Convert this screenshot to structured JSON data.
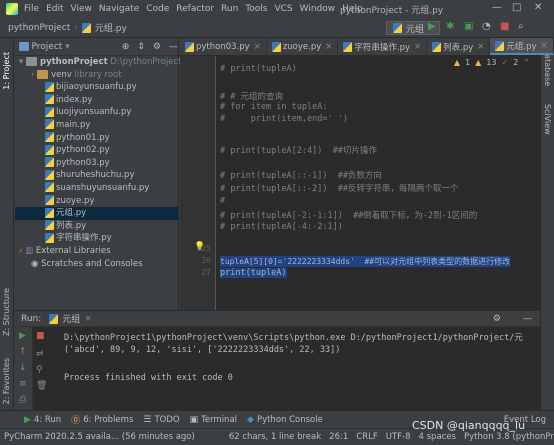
{
  "menubar": {
    "items": [
      "File",
      "Edit",
      "View",
      "Navigate",
      "Code",
      "Refactor",
      "Run",
      "Tools",
      "VCS",
      "Window",
      "Help"
    ],
    "title": "pythonProject - 元组.py"
  },
  "navbar": {
    "project": "pythonProject",
    "file": "元组.py",
    "run_config": "元组"
  },
  "left_stripe": {
    "project": "1: Project",
    "structure": "Z: Structure",
    "favorites": "2: Favorites"
  },
  "right_stripe": {
    "database": "Database",
    "sciview": "SciView"
  },
  "project_panel": {
    "title": "Project",
    "root": {
      "name": "pythonProject",
      "path": "D:\\pythonProject1\\p"
    },
    "venv": {
      "name": "venv",
      "note": "library root"
    },
    "files": [
      "bijiaoyunsuanfu.py",
      "index.py",
      "luojiyunsuanfu.py",
      "main.py",
      "python01.py",
      "python02.py",
      "python03.py",
      "shuruheshuchu.py",
      "suanshuyunsuanfu.py",
      "zuoye.py",
      "元组.py",
      "列表.py",
      "字符串操作.py"
    ],
    "selected": "元组.py",
    "external": "External Libraries",
    "scratches": "Scratches and Consoles"
  },
  "tabs": [
    {
      "label": "python03.py",
      "active": false
    },
    {
      "label": "zuoye.py",
      "active": false
    },
    {
      "label": "字符串操作.py",
      "active": false
    },
    {
      "label": "列表.py",
      "active": false
    },
    {
      "label": "元组.py",
      "active": true
    }
  ],
  "inspections": {
    "warnings": "1",
    "weak": "13",
    "typos": "2"
  },
  "editor": {
    "lines": [
      {
        "n": "",
        "text": "# print(tupleA)",
        "kind": "cmt"
      },
      {
        "n": "",
        "text": "",
        "kind": "cmt"
      },
      {
        "n": "",
        "text": "# # 元组的查询",
        "kind": "cmt"
      },
      {
        "n": "",
        "text": "# for item in tupleA:",
        "kind": "cmt"
      },
      {
        "n": "",
        "text": "#     print(item,end=' ')",
        "kind": "cmt"
      },
      {
        "n": "",
        "text": "",
        "kind": "cmt"
      },
      {
        "n": "",
        "text": "# print(tupleA[2:4])  ##切片操作",
        "kind": "cmt"
      },
      {
        "n": "",
        "text": "",
        "kind": "cmt"
      },
      {
        "n": "",
        "text": "# print(tupleA[::-1])  ##负数方向",
        "kind": "cmt"
      },
      {
        "n": "",
        "text": "# print(tupleA[::-2])  ##反转字符串，每隔两个取一个",
        "kind": "cmt"
      },
      {
        "n": "",
        "text": "#",
        "kind": "cmt"
      },
      {
        "n": "",
        "text": "# print(tupleA[-2:-1:1])  ##倒着取下标，为-2到-1区间的",
        "kind": "cmt"
      },
      {
        "n": "",
        "text": "# print(tupleA[-4:-2:1])",
        "kind": "cmt"
      },
      {
        "n": "25",
        "text": "",
        "kind": "cmt"
      },
      {
        "n": "26",
        "text": "tupleA[5][0]='2222223334dds'  ##可以对元组中列表类型的数据进行修改",
        "kind": "sel"
      },
      {
        "n": "27",
        "text": "print(tupleA)",
        "kind": "sel"
      }
    ]
  },
  "run": {
    "label": "Run:",
    "config": "元组",
    "output": [
      "D:\\pythonProject1\\pythonProject\\venv\\Scripts\\python.exe D:/pythonProject1/pythonProject/元",
      "('abcd', 89, 9, 12, 'sisi', ['2222223334dds', 22, 33])",
      "",
      "Process finished with exit code 0"
    ]
  },
  "toolstrip": {
    "items": [
      {
        "icon": "▶",
        "label": "4: Run"
      },
      {
        "icon": "⓪",
        "label": "6: Problems"
      },
      {
        "icon": "☰",
        "label": "TODO"
      },
      {
        "icon": "▣",
        "label": "Terminal"
      },
      {
        "icon": "◆",
        "label": "Python Console"
      }
    ],
    "event_log": "Event Log"
  },
  "statusbar": {
    "message": "PyCharm 2020.2.5 availa... (56 minutes ago)",
    "chars": "62 chars, 1 line break",
    "position": "26:1",
    "line_sep": "CRLF",
    "encoding": "UTF-8",
    "indent": "4 spaces",
    "interpreter": "Python 3.8 (pythonProject)"
  },
  "watermark": "CSDN @qianqqqq_lu"
}
